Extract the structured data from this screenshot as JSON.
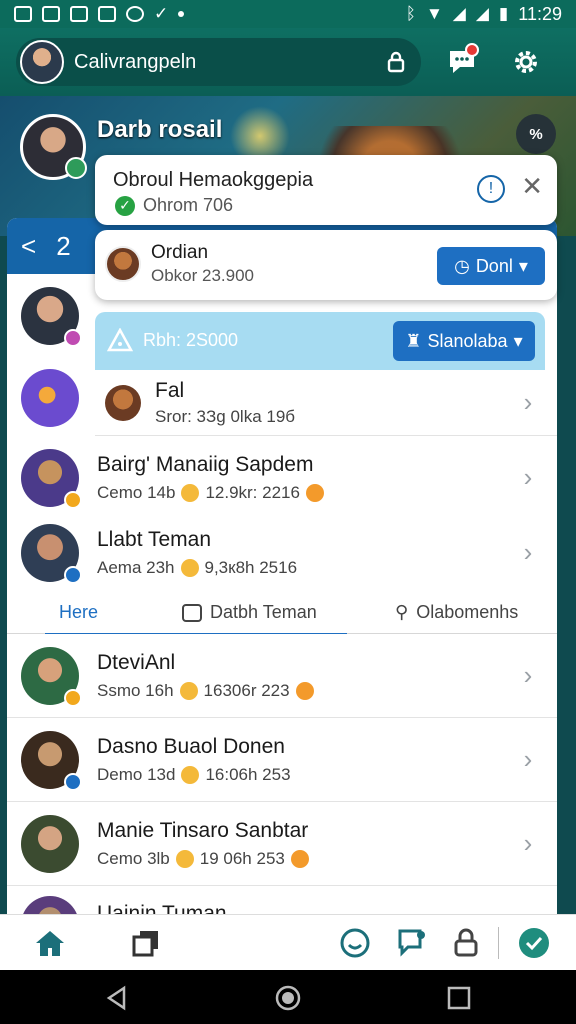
{
  "status_bar": {
    "time": "11:29"
  },
  "app_bar": {
    "title": "Calivrangpeln"
  },
  "banner": {
    "name": "Darb rosail",
    "percent_label": "%"
  },
  "sheet_header": {
    "back": "<",
    "count": "2"
  },
  "popup_notice": {
    "title": "Obroul Hemaokggepia",
    "subtitle": "Ohrom 706"
  },
  "popup_order": {
    "title": "Ordian",
    "subtitle": "Obkor 23.900",
    "button": "Donl"
  },
  "popup_nav": {
    "text": "Rbh: 2S000",
    "button": "Slanolaba"
  },
  "rows_top": [
    {
      "name": "Fal",
      "meta": "Sror: 3Зg 0lka 19б"
    },
    {
      "name": "Bairg' Manaiig Sapdem",
      "meta_a": "Cemo 14b",
      "meta_b": "12.9kr: 2216"
    },
    {
      "name": "Llabt Teman",
      "meta_a": "Aema 23h",
      "meta_b": "9,3к8h 2516"
    }
  ],
  "tabs": [
    {
      "label": "Here"
    },
    {
      "label": "Datbh Teman"
    },
    {
      "label": "Olabomenhs"
    }
  ],
  "rows_bottom": [
    {
      "name": "DteviAnl",
      "meta_a": "Ssmo 16h",
      "meta_b": "16306r 223"
    },
    {
      "name": "Dasno Buaol Donen",
      "meta_a": "Demo 13d",
      "meta_b": "16:06h 253"
    },
    {
      "name": "Manie Tinsaro Sanbtar",
      "meta_a": "Cemo 3lb",
      "meta_b": "19 06h 253"
    },
    {
      "name": "Uainin Tuman"
    }
  ],
  "colors": {
    "primary": "#1e6fc2",
    "teal": "#0c6b5c",
    "accent_green": "#27a243"
  }
}
